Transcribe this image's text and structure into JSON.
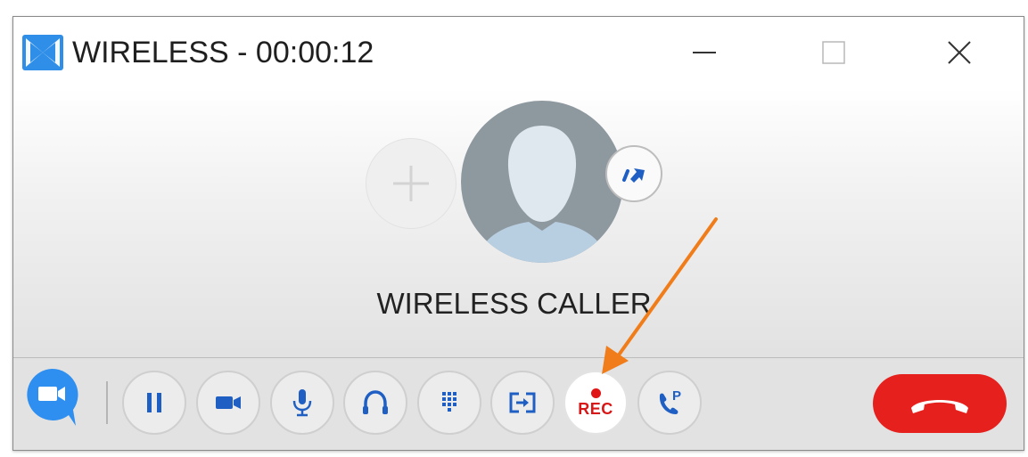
{
  "window": {
    "title": "WIRELESS - 00:00:12",
    "app_icon": "app-logo-icon",
    "controls": [
      "minimize-icon",
      "maximize-icon",
      "close-icon"
    ]
  },
  "call": {
    "caller_name": "WIRELESS CALLER",
    "add_participant_icon": "plus-icon",
    "transfer_badge_icon": "forward-arrow-icon"
  },
  "toolbar": {
    "buttons": [
      {
        "name": "video-call-button",
        "icon": "video-camera-icon"
      },
      {
        "name": "hold-button",
        "icon": "pause-icon"
      },
      {
        "name": "video-button",
        "icon": "video-camera-icon"
      },
      {
        "name": "mute-button",
        "icon": "microphone-icon"
      },
      {
        "name": "headset-button",
        "icon": "headset-icon"
      },
      {
        "name": "dialpad-button",
        "icon": "dialpad-icon"
      },
      {
        "name": "transfer-button",
        "icon": "transfer-icon"
      },
      {
        "name": "record-button",
        "icon": "record-dot-icon"
      },
      {
        "name": "park-button",
        "icon": "phone-park-icon"
      },
      {
        "name": "hangup-button",
        "icon": "hang-up-icon"
      }
    ],
    "rec_label": "REC",
    "park_letter": "P"
  },
  "colors": {
    "accent_blue": "#1a73e8",
    "icon_blue": "#1f5fc4",
    "hangup_red": "#e5201d",
    "rec_red": "#d81818",
    "annotation_orange": "#f07d1a"
  }
}
